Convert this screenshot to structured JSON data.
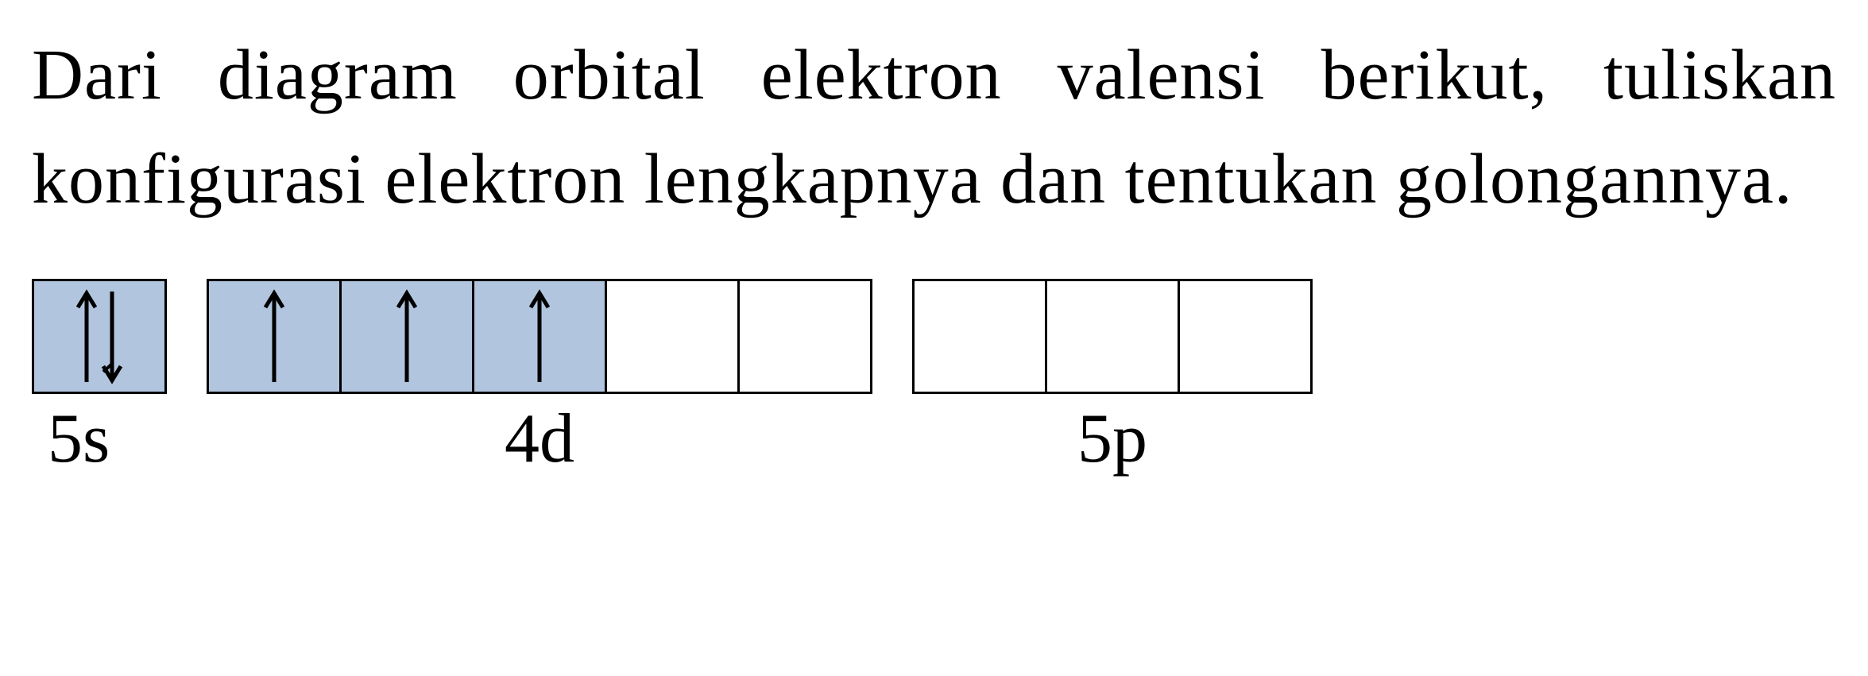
{
  "question": {
    "text": "Dari diagram orbital elektron valensi berikut, tuliskan konfigurasi elektron lengkapnya dan tentukan golongannya."
  },
  "orbitals": {
    "group_5s": {
      "label": "5s",
      "boxes": [
        {
          "filled": true,
          "arrows": "updown"
        }
      ]
    },
    "group_4d": {
      "label": "4d",
      "boxes": [
        {
          "filled": true,
          "arrows": "up"
        },
        {
          "filled": true,
          "arrows": "up"
        },
        {
          "filled": true,
          "arrows": "up"
        },
        {
          "filled": false,
          "arrows": "none"
        },
        {
          "filled": false,
          "arrows": "none"
        }
      ]
    },
    "group_5p": {
      "label": "5p",
      "boxes": [
        {
          "filled": false,
          "arrows": "none"
        },
        {
          "filled": false,
          "arrows": "none"
        },
        {
          "filled": false,
          "arrows": "none"
        }
      ]
    }
  }
}
